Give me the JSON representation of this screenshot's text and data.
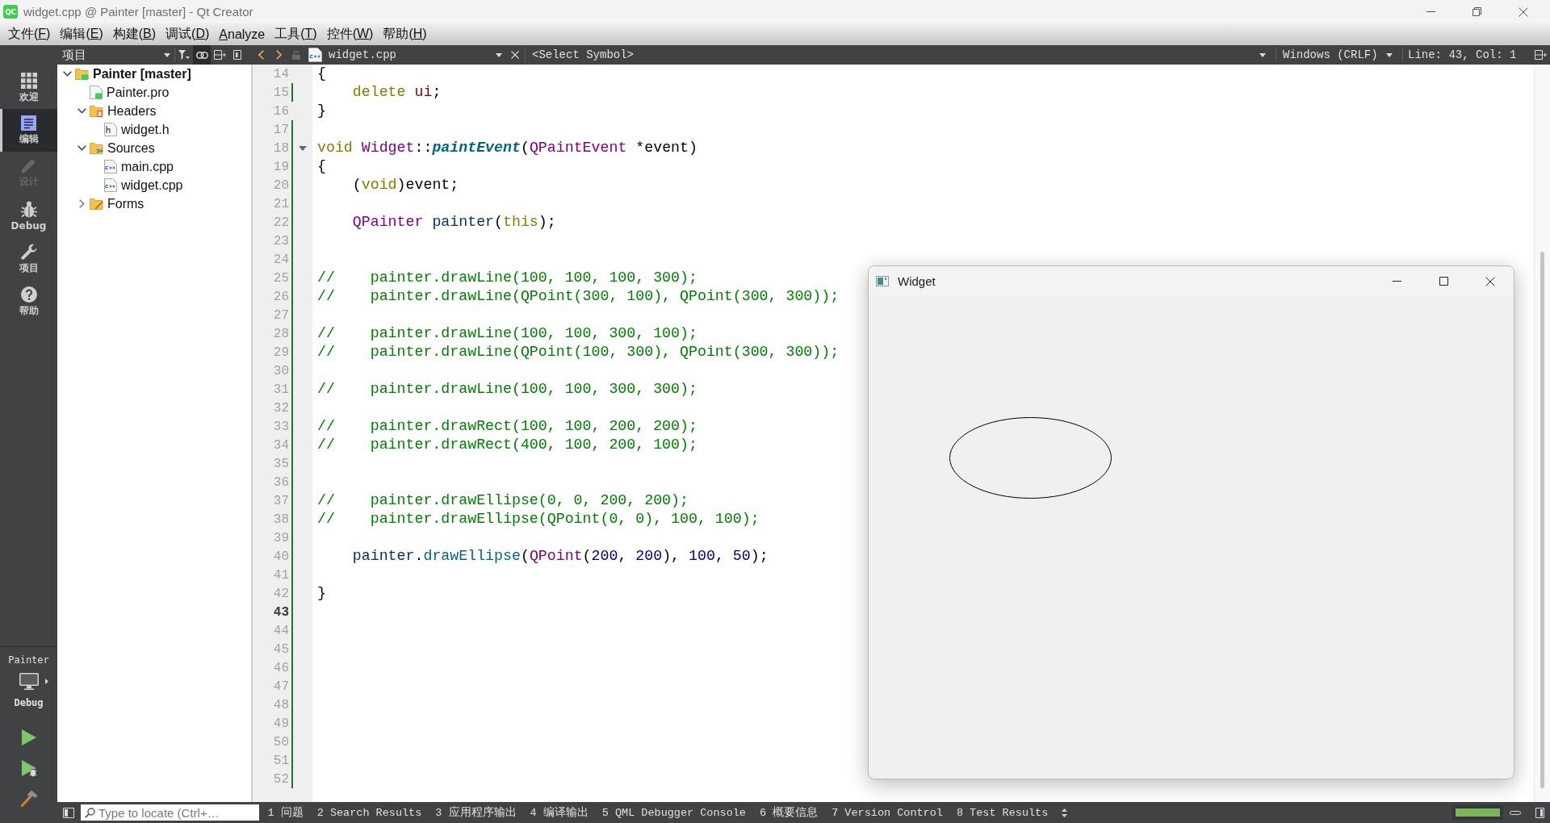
{
  "window": {
    "icon_text": "QC",
    "title": "widget.cpp @ Painter [master] - Qt Creator"
  },
  "menu_bar": [
    {
      "label_before": "文件(",
      "mnemonic": "F",
      "label_after": ")"
    },
    {
      "label_before": "编辑(",
      "mnemonic": "E",
      "label_after": ")"
    },
    {
      "label_before": "构建(",
      "mnemonic": "B",
      "label_after": ")"
    },
    {
      "label_before": "调试(",
      "mnemonic": "D",
      "label_after": ")"
    },
    {
      "mnemonic": "A",
      "label_after": "nalyze"
    },
    {
      "label_before": "工具(",
      "mnemonic": "T",
      "label_after": ")"
    },
    {
      "label_before": "控件(",
      "mnemonic": "W",
      "label_after": ")"
    },
    {
      "label_before": "帮助(",
      "mnemonic": "H",
      "label_after": ")"
    }
  ],
  "mode_bar": {
    "modes": [
      {
        "kind": "welcome",
        "label": "欢迎",
        "selected": false,
        "disabled": false
      },
      {
        "kind": "edit",
        "label": "编辑",
        "selected": true,
        "disabled": false
      },
      {
        "kind": "design",
        "label": "设计",
        "selected": false,
        "disabled": true
      },
      {
        "kind": "debug",
        "label": "Debug",
        "selected": false,
        "disabled": false
      },
      {
        "kind": "projects",
        "label": "项目",
        "selected": false,
        "disabled": false
      },
      {
        "kind": "help",
        "label": "帮助",
        "selected": false,
        "disabled": false
      }
    ],
    "target": {
      "project": "Painter",
      "build_config": "Debug"
    }
  },
  "project_pane": {
    "view": "项目",
    "link_with_editor": true
  },
  "project_tree": [
    {
      "kind": "project",
      "label": "Painter [master]",
      "expanded": true,
      "children": [
        {
          "kind": "project-file",
          "label": "Painter.pro"
        },
        {
          "kind": "headers-folder",
          "label": "Headers",
          "expanded": true,
          "children": [
            {
              "kind": "header-file",
              "label": "widget.h"
            }
          ]
        },
        {
          "kind": "sources-folder",
          "label": "Sources",
          "expanded": true,
          "children": [
            {
              "kind": "source-file",
              "label": "main.cpp"
            },
            {
              "kind": "source-file",
              "label": "widget.cpp"
            }
          ]
        },
        {
          "kind": "forms-folder",
          "label": "Forms",
          "expanded": false
        }
      ]
    }
  ],
  "editor_toolbar": {
    "file": "widget.cpp",
    "symbol": "<Select Symbol>",
    "line_endings": "Windows (CRLF)",
    "cursor_position": "Line: 43, Col: 1"
  },
  "editor": {
    "lines": [
      {
        "number": "14",
        "current": false,
        "modified": false,
        "fold_marker": false,
        "tokens": [
          {
            "kind": "plain",
            "text": "{"
          }
        ]
      },
      {
        "number": "15",
        "current": false,
        "modified": true,
        "fold_marker": false,
        "tokens": [
          {
            "kind": "keyword",
            "text": "    delete "
          },
          {
            "kind": "field",
            "text": "ui"
          },
          {
            "kind": "plain",
            "text": ";"
          }
        ]
      },
      {
        "number": "16",
        "current": false,
        "modified": false,
        "fold_marker": false,
        "tokens": [
          {
            "kind": "plain",
            "text": "}"
          }
        ]
      },
      {
        "number": "17",
        "current": false,
        "modified": true,
        "fold_marker": false
      },
      {
        "number": "18",
        "current": false,
        "modified": true,
        "fold_marker": true,
        "tokens": [
          {
            "kind": "keyword",
            "text": "void "
          },
          {
            "kind": "type",
            "text": "Widget"
          },
          {
            "kind": "plain",
            "text": "::"
          },
          {
            "kind": "declaration",
            "text": "paintEvent"
          },
          {
            "kind": "plain",
            "text": "("
          },
          {
            "kind": "type",
            "text": "QPaintEvent"
          },
          {
            "kind": "plain",
            "text": " *event)"
          }
        ]
      },
      {
        "number": "19",
        "current": false,
        "modified": true,
        "fold_marker": false,
        "tokens": [
          {
            "kind": "plain",
            "text": "{"
          }
        ]
      },
      {
        "number": "20",
        "current": false,
        "modified": true,
        "fold_marker": false,
        "tokens": [
          {
            "kind": "plain",
            "text": "    ("
          },
          {
            "kind": "keyword",
            "text": "void"
          },
          {
            "kind": "plain",
            "text": ")event;"
          }
        ]
      },
      {
        "number": "21",
        "current": false,
        "modified": true,
        "fold_marker": false
      },
      {
        "number": "22",
        "current": false,
        "modified": true,
        "fold_marker": false,
        "tokens": [
          {
            "kind": "type",
            "text": "    QPainter "
          },
          {
            "kind": "local",
            "text": "painter"
          },
          {
            "kind": "plain",
            "text": "("
          },
          {
            "kind": "keyword",
            "text": "this"
          },
          {
            "kind": "plain",
            "text": ");"
          }
        ]
      },
      {
        "number": "23",
        "current": false,
        "modified": true,
        "fold_marker": false
      },
      {
        "number": "24",
        "current": false,
        "modified": true,
        "fold_marker": false
      },
      {
        "number": "25",
        "current": false,
        "modified": true,
        "fold_marker": false,
        "tokens": [
          {
            "kind": "comment",
            "text": "//    painter.drawLine(100, 100, 100, 300);"
          }
        ]
      },
      {
        "number": "26",
        "current": false,
        "modified": true,
        "fold_marker": false,
        "tokens": [
          {
            "kind": "comment",
            "text": "//    painter.drawLine(QPoint(300, 100), QPoint(300, 300));"
          }
        ]
      },
      {
        "number": "27",
        "current": false,
        "modified": true,
        "fold_marker": false
      },
      {
        "number": "28",
        "current": false,
        "modified": true,
        "fold_marker": false,
        "tokens": [
          {
            "kind": "comment",
            "text": "//    painter.drawLine(100, 100, 300, 100);"
          }
        ]
      },
      {
        "number": "29",
        "current": false,
        "modified": true,
        "fold_marker": false,
        "tokens": [
          {
            "kind": "comment",
            "text": "//    painter.drawLine(QPoint(100, 300), QPoint(300, 300));"
          }
        ]
      },
      {
        "number": "30",
        "current": false,
        "modified": true,
        "fold_marker": false
      },
      {
        "number": "31",
        "current": false,
        "modified": true,
        "fold_marker": false,
        "tokens": [
          {
            "kind": "comment",
            "text": "//    painter.drawLine(100, 100, 300, 300);"
          }
        ]
      },
      {
        "number": "32",
        "current": false,
        "modified": true,
        "fold_marker": false
      },
      {
        "number": "33",
        "current": false,
        "modified": true,
        "fold_marker": false,
        "tokens": [
          {
            "kind": "comment",
            "text": "//    painter.drawRect(100, 100, 200, 200);"
          }
        ]
      },
      {
        "number": "34",
        "current": false,
        "modified": true,
        "fold_marker": false,
        "tokens": [
          {
            "kind": "comment",
            "text": "//    painter.drawRect(400, 100, 200, 100);"
          }
        ]
      },
      {
        "number": "35",
        "current": false,
        "modified": true,
        "fold_marker": false
      },
      {
        "number": "36",
        "current": false,
        "modified": true,
        "fold_marker": false
      },
      {
        "number": "37",
        "current": false,
        "modified": true,
        "fold_marker": false,
        "tokens": [
          {
            "kind": "comment",
            "text": "//    painter.drawEllipse(0, 0, 200, 200);"
          }
        ]
      },
      {
        "number": "38",
        "current": false,
        "modified": true,
        "fold_marker": false,
        "tokens": [
          {
            "kind": "comment",
            "text": "//    painter.drawEllipse(QPoint(0, 0), 100, 100);"
          }
        ]
      },
      {
        "number": "39",
        "current": false,
        "modified": true,
        "fold_marker": false
      },
      {
        "number": "40",
        "current": false,
        "modified": true,
        "fold_marker": false,
        "tokens": [
          {
            "kind": "local",
            "text": "    painter"
          },
          {
            "kind": "plain",
            "text": "."
          },
          {
            "kind": "call",
            "text": "drawEllipse"
          },
          {
            "kind": "plain",
            "text": "("
          },
          {
            "kind": "type",
            "text": "QPoint"
          },
          {
            "kind": "plain",
            "text": "("
          },
          {
            "kind": "number",
            "text": "200"
          },
          {
            "kind": "plain",
            "text": ", "
          },
          {
            "kind": "number",
            "text": "200"
          },
          {
            "kind": "plain",
            "text": "), "
          },
          {
            "kind": "number",
            "text": "100"
          },
          {
            "kind": "plain",
            "text": ", "
          },
          {
            "kind": "number",
            "text": "50"
          },
          {
            "kind": "plain",
            "text": ");"
          }
        ]
      },
      {
        "number": "41",
        "current": false,
        "modified": true,
        "fold_marker": false
      },
      {
        "number": "42",
        "current": false,
        "modified": true,
        "fold_marker": false,
        "tokens": [
          {
            "kind": "plain",
            "text": "}"
          }
        ]
      },
      {
        "number": "43",
        "current": true,
        "modified": true,
        "fold_marker": false
      },
      {
        "number": "44",
        "current": false,
        "modified": true,
        "fold_marker": false
      },
      {
        "number": "45",
        "current": false,
        "modified": true,
        "fold_marker": false
      },
      {
        "number": "46",
        "current": false,
        "modified": true,
        "fold_marker": false
      },
      {
        "number": "47",
        "current": false,
        "modified": true,
        "fold_marker": false
      },
      {
        "number": "48",
        "current": false,
        "modified": true,
        "fold_marker": false
      },
      {
        "number": "49",
        "current": false,
        "modified": true,
        "fold_marker": false
      },
      {
        "number": "50",
        "current": false,
        "modified": true,
        "fold_marker": false
      },
      {
        "number": "51",
        "current": false,
        "modified": true,
        "fold_marker": false
      },
      {
        "number": "52",
        "current": false,
        "modified": true,
        "fold_marker": false
      }
    ]
  },
  "status_bar": {
    "locator": {
      "placeholder": "Type to locate (Ctrl+…"
    },
    "output_panes": [
      "1 问题",
      "2 Search Results",
      "3 应用程序输出",
      "4 编译输出",
      "5 QML Debugger Console",
      "6 概要信息",
      "7 Version Control",
      "8 Test Results"
    ],
    "progress": {
      "level": 1
    }
  },
  "widget_window": {
    "title": "Widget"
  }
}
